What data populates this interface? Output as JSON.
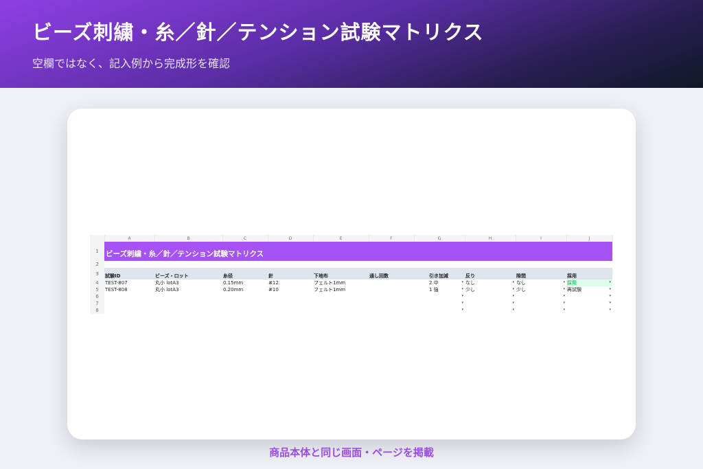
{
  "header": {
    "title": "ビーズ刺繍・糸／針／テンション試験マトリクス",
    "subtitle": "空欄ではなく、記入例から完成形を確認"
  },
  "sheet": {
    "column_letters": [
      "A",
      "B",
      "C",
      "D",
      "E",
      "F",
      "G",
      "H",
      "I",
      "J"
    ],
    "row_numbers": [
      "1",
      "2",
      "3",
      "4",
      "5",
      "6",
      "7",
      "8"
    ],
    "title": "ビーズ刺繍・糸／針／テンション試験マトリクス",
    "headers": [
      "試験ID",
      "ビーズ・ロット",
      "糸径",
      "針",
      "下地布",
      "通し回数",
      "引き加減",
      "反り",
      "隙間",
      "採用"
    ],
    "rows": [
      [
        "TEST-807",
        "丸小 lotA3",
        "0.15mm",
        "#12",
        "フェルト1mm",
        "",
        "2 中",
        "なし",
        "なし",
        "採用"
      ],
      [
        "TEST-808",
        "丸小 lotA3",
        "0.20mm",
        "#10",
        "フェルト1mm",
        "",
        "1 強",
        "少し",
        "少し",
        "再試験"
      ]
    ],
    "dropdown_glyph": "▾"
  },
  "footer": {
    "caption": "商品本体と同じ画面・ページを掲載"
  },
  "colors": {
    "title_band": "#a652f7",
    "header_band": "#dfe5ee",
    "adopt_fill": "#dcfce7"
  }
}
